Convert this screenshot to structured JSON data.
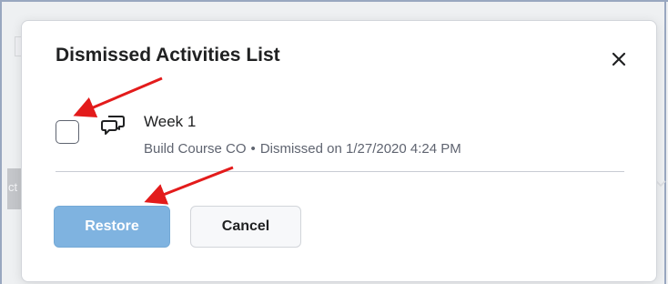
{
  "background": {
    "left_tab_text": "ct"
  },
  "dialog": {
    "title": "Dismissed Activities List",
    "close_icon": "close-icon",
    "items": [
      {
        "icon": "discussion-icon",
        "title": "Week 1",
        "course": "Build Course CO",
        "separator": "•",
        "dismissed_text": "Dismissed on 1/27/2020 4:24 PM",
        "checked": false
      }
    ],
    "buttons": {
      "restore_label": "Restore",
      "cancel_label": "Cancel"
    }
  },
  "colors": {
    "primary_disabled": "#7fb3e0",
    "annotation_red": "#e31b1b",
    "frame_blue": "#1f3f79"
  }
}
